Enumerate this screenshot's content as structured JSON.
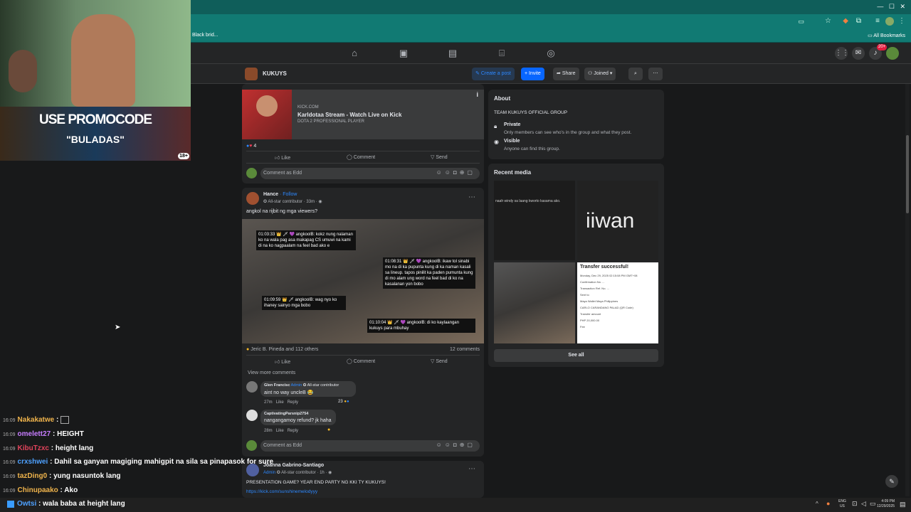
{
  "browser": {
    "bookmark_left": "Black brid...",
    "bookmark_right": "All Bookmarks"
  },
  "nav": {
    "notif_badge": "20+"
  },
  "group": {
    "name": "KUKUYS",
    "create_post": "Create a post",
    "invite": "Invite",
    "share": "Share",
    "joined": "Joined"
  },
  "post1": {
    "domain": "KICK.COM",
    "title": "Karldotaa Stream - Watch Live on Kick",
    "desc": "DOTA 2 PROFESSIONAL PLAYER",
    "reactions": "4",
    "like": "Like",
    "comment": "Comment",
    "send": "Send",
    "comment_as": "Comment as Edd"
  },
  "post2": {
    "author": "Hance",
    "follow": "· Follow",
    "badge": "All-star contributor",
    "time": "· 33m ·",
    "text": "angkol na rijbit ng mga viewers?",
    "captions": [
      "01:03:33 👑 🗡 💜 angkoolB: kokz nung nalaman ko na wala pag asa makapag CS umuwi na kami di na ko nagpaalam na feel bad ako e",
      "01:08:31 👑 🗡 💜 angkoolB: ikaw tol sinabi mo na di ka pupunta kung di ka naman kasali sa lineup. tapos pinilit ka paden pumunta kung di mo alam ung word na feel bad di ko na kasalanan yon bobo",
      "01:09:59 👑 🗡 angkoolB: wag nyo ko ihaney sainyo mga bobo",
      "01:10:04 👑 🗡 💜 angkoolB: di ko kaylaangan kukuys para mbuhay"
    ],
    "reactors": "Jeric B. Pineda and 112 others",
    "comments_count": "12 comments",
    "like": "Like",
    "comment": "Comment",
    "send": "Send",
    "view_more": "View more comments",
    "comment_as": "Comment as Edd",
    "comments": [
      {
        "name": "Glen Francisc",
        "role": "Admin",
        "badge": "All-star contributor",
        "text": "aint no way uncleB 😂",
        "time": "27m",
        "like": "Like",
        "reply": "Reply",
        "count": "23"
      },
      {
        "name": "CaptivatingParsnip2754",
        "text": "nangangamoy refund? jk haha",
        "time": "28m",
        "like": "Like",
        "reply": "Reply"
      }
    ]
  },
  "post3": {
    "author": "Joanna Gabrino-Santiago",
    "role": "Admin",
    "badge": "All-star contributor",
    "time": "· 1h ·",
    "text": "PRESENTATION GAME? YEAR END PARTY NG KKI TY KUKUYS!",
    "link": "https://kick.com/sunshinemelodyyy"
  },
  "about": {
    "title": "About",
    "desc": "TEAM KUKUYS OFFICIAL GROUP",
    "private_title": "Private",
    "private_desc": "Only members can see who's in the group and what they post.",
    "visible_title": "Visible",
    "visible_desc": "Anyone can find this group."
  },
  "media": {
    "title": "Recent media",
    "thumb1_text": "naah windy sa laang kworto kasama ako.",
    "thumb2_text": "iiwan",
    "thumb4_title": "Transfer successful!",
    "thumb4_lines": [
      "Monday, Dec 29, 2025 02:15:08 PM GMT+08",
      "Confirmation No. ...",
      "Transaction Ref. No. ...",
      "Sent to",
      "Maya Wallet Maya Philippines",
      "CARLO CARANDANG PALAD (QR Code)",
      "Transfer amount",
      "PHP 20,000.00",
      "Fee"
    ],
    "see_all": "See all"
  },
  "overlay": {
    "promo_line1": "USE PROMOCODE",
    "promo_line2": "\"BULADAS\"",
    "age": "18+"
  },
  "chat": [
    {
      "time": "16:09",
      "user": "Nakakatwe",
      "color": "#f0b44c",
      "msg": ":"
    },
    {
      "time": "16:09",
      "user": "omelett27",
      "color": "#c77dff",
      "msg": ": HEIGHT"
    },
    {
      "time": "16:09",
      "user": "KibuTzxc",
      "color": "#e0435b",
      "msg": ": height lang"
    },
    {
      "time": "16:09",
      "user": "crxshwei",
      "color": "#4ea1ff",
      "msg": ": Dahil sa ganyan magiging mahigpit na sila sa pinapasok for sure"
    },
    {
      "time": "16:09",
      "user": "tazDing0",
      "color": "#f0b44c",
      "msg": ": yung nasuntok lang"
    },
    {
      "time": "16:09",
      "user": "Chinupaako",
      "color": "#f0b44c",
      "msg": ": Ako"
    },
    {
      "time": "16:09",
      "user": "Owtsi",
      "color": "#4ea1ff",
      "msg": ": wala baba at height lang"
    }
  ],
  "taskbar": {
    "lang1": "ENG",
    "lang2": "US",
    "time": "4:09 PM",
    "date": "12/29/2025"
  }
}
